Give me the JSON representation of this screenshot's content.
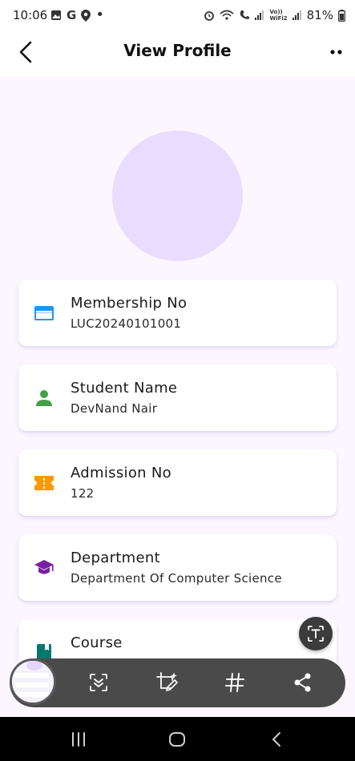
{
  "status_bar": {
    "time": "10:06",
    "battery": "81%",
    "volte_label": "Vo))\nWiFi2"
  },
  "app_bar": {
    "title": "View Profile"
  },
  "profile": {
    "avatar_color": "#e8dcff",
    "fields": [
      {
        "label": "Membership No",
        "value": "LUC20240101001",
        "icon": "credit-card-icon",
        "color": "#2196f3"
      },
      {
        "label": "Student Name",
        "value": "DevNand Nair",
        "icon": "person-icon",
        "color": "#43a047"
      },
      {
        "label": "Admission No",
        "value": "122",
        "icon": "ticket-icon",
        "color": "#ff9800"
      },
      {
        "label": "Department",
        "value": "Department Of Computer Science",
        "icon": "graduation-cap-icon",
        "color": "#7b1fa2"
      },
      {
        "label": "Course",
        "value": "",
        "icon": "book-icon",
        "color": "#00796b"
      }
    ]
  }
}
